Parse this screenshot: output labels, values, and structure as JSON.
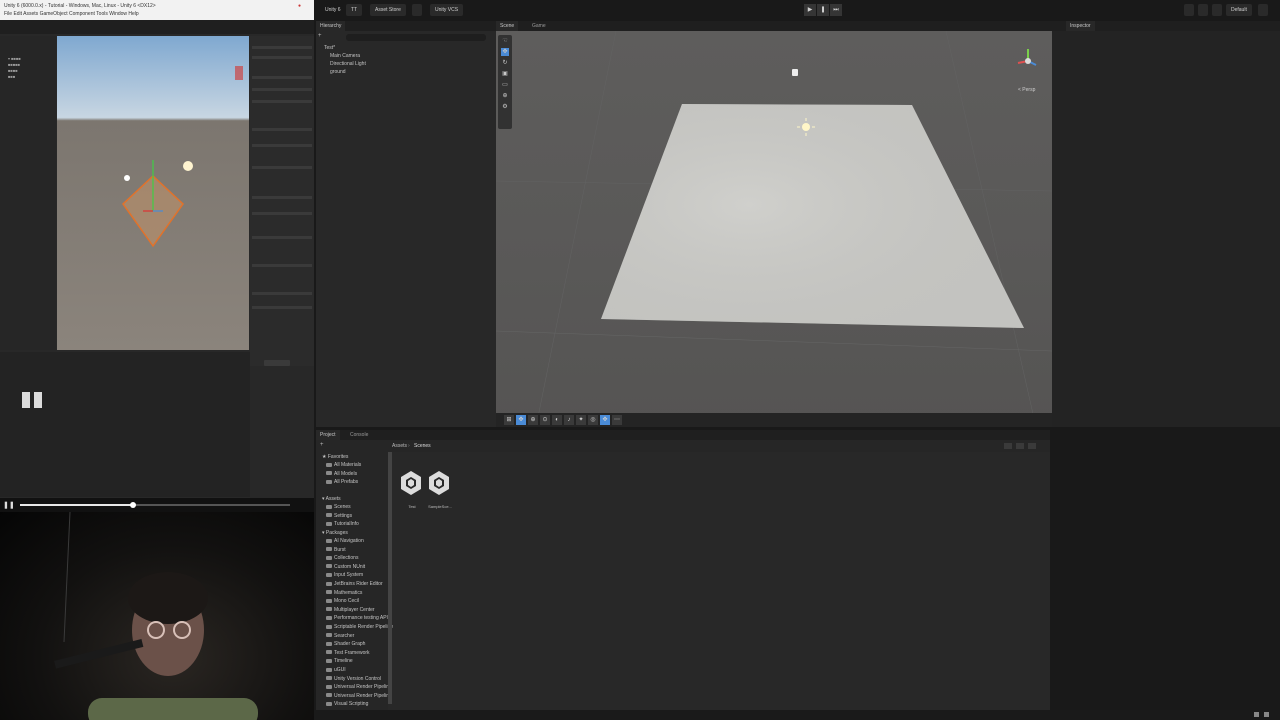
{
  "video": {
    "title": "Unity 6 (6000.0.x) - Tutorial - Windows, Mac, Linux - Unity 6 <DX12>",
    "menu": "File  Edit  Assets  GameObject  Component  Tools  Window  Help",
    "progress_fraction": 0.42
  },
  "topbar": {
    "app_label": "Unity 6",
    "account_label": "TT",
    "asset_store_label": "Asset Store",
    "vcs_label": "Unity VCS",
    "layout_label": "Default"
  },
  "hierarchy": {
    "tab_label": "Hierarchy",
    "scene_root": "Test*",
    "items": [
      "Main Camera",
      "Directional Light",
      "ground"
    ]
  },
  "scene": {
    "tab_scene": "Scene",
    "tab_game": "Game",
    "gizmo_label": "< Persp"
  },
  "inspector": {
    "tab_label": "Inspector"
  },
  "project": {
    "tab_project": "Project",
    "tab_console": "Console",
    "breadcrumb_root": "Assets",
    "breadcrumb_current": "Scenes",
    "favorites": {
      "label": "Favorites",
      "items": [
        "All Materials",
        "All Models",
        "All Prefabs"
      ]
    },
    "assets": {
      "label": "Assets",
      "items": [
        "Scenes",
        "Settings",
        "TutorialInfo"
      ]
    },
    "packages": {
      "label": "Packages",
      "items": [
        "AI Navigation",
        "Burst",
        "Collections",
        "Custom NUnit",
        "Input System",
        "JetBrains Rider Editor",
        "Mathematics",
        "Mono Cecil",
        "Multiplayer Center",
        "Performance testing API",
        "Scriptable Render Pipeline",
        "Searcher",
        "Shader Graph",
        "Test Framework",
        "Timeline",
        "uGUI",
        "Unity Version Control",
        "Universal Render Pipeline",
        "Universal Render Pipeline",
        "Visual Scripting"
      ]
    },
    "files": [
      "Test",
      "SampleSce..."
    ]
  },
  "colors": {
    "editor_bg": "#282828",
    "accent_blue": "#4a8bd6",
    "plane": "#c9c9c5"
  }
}
